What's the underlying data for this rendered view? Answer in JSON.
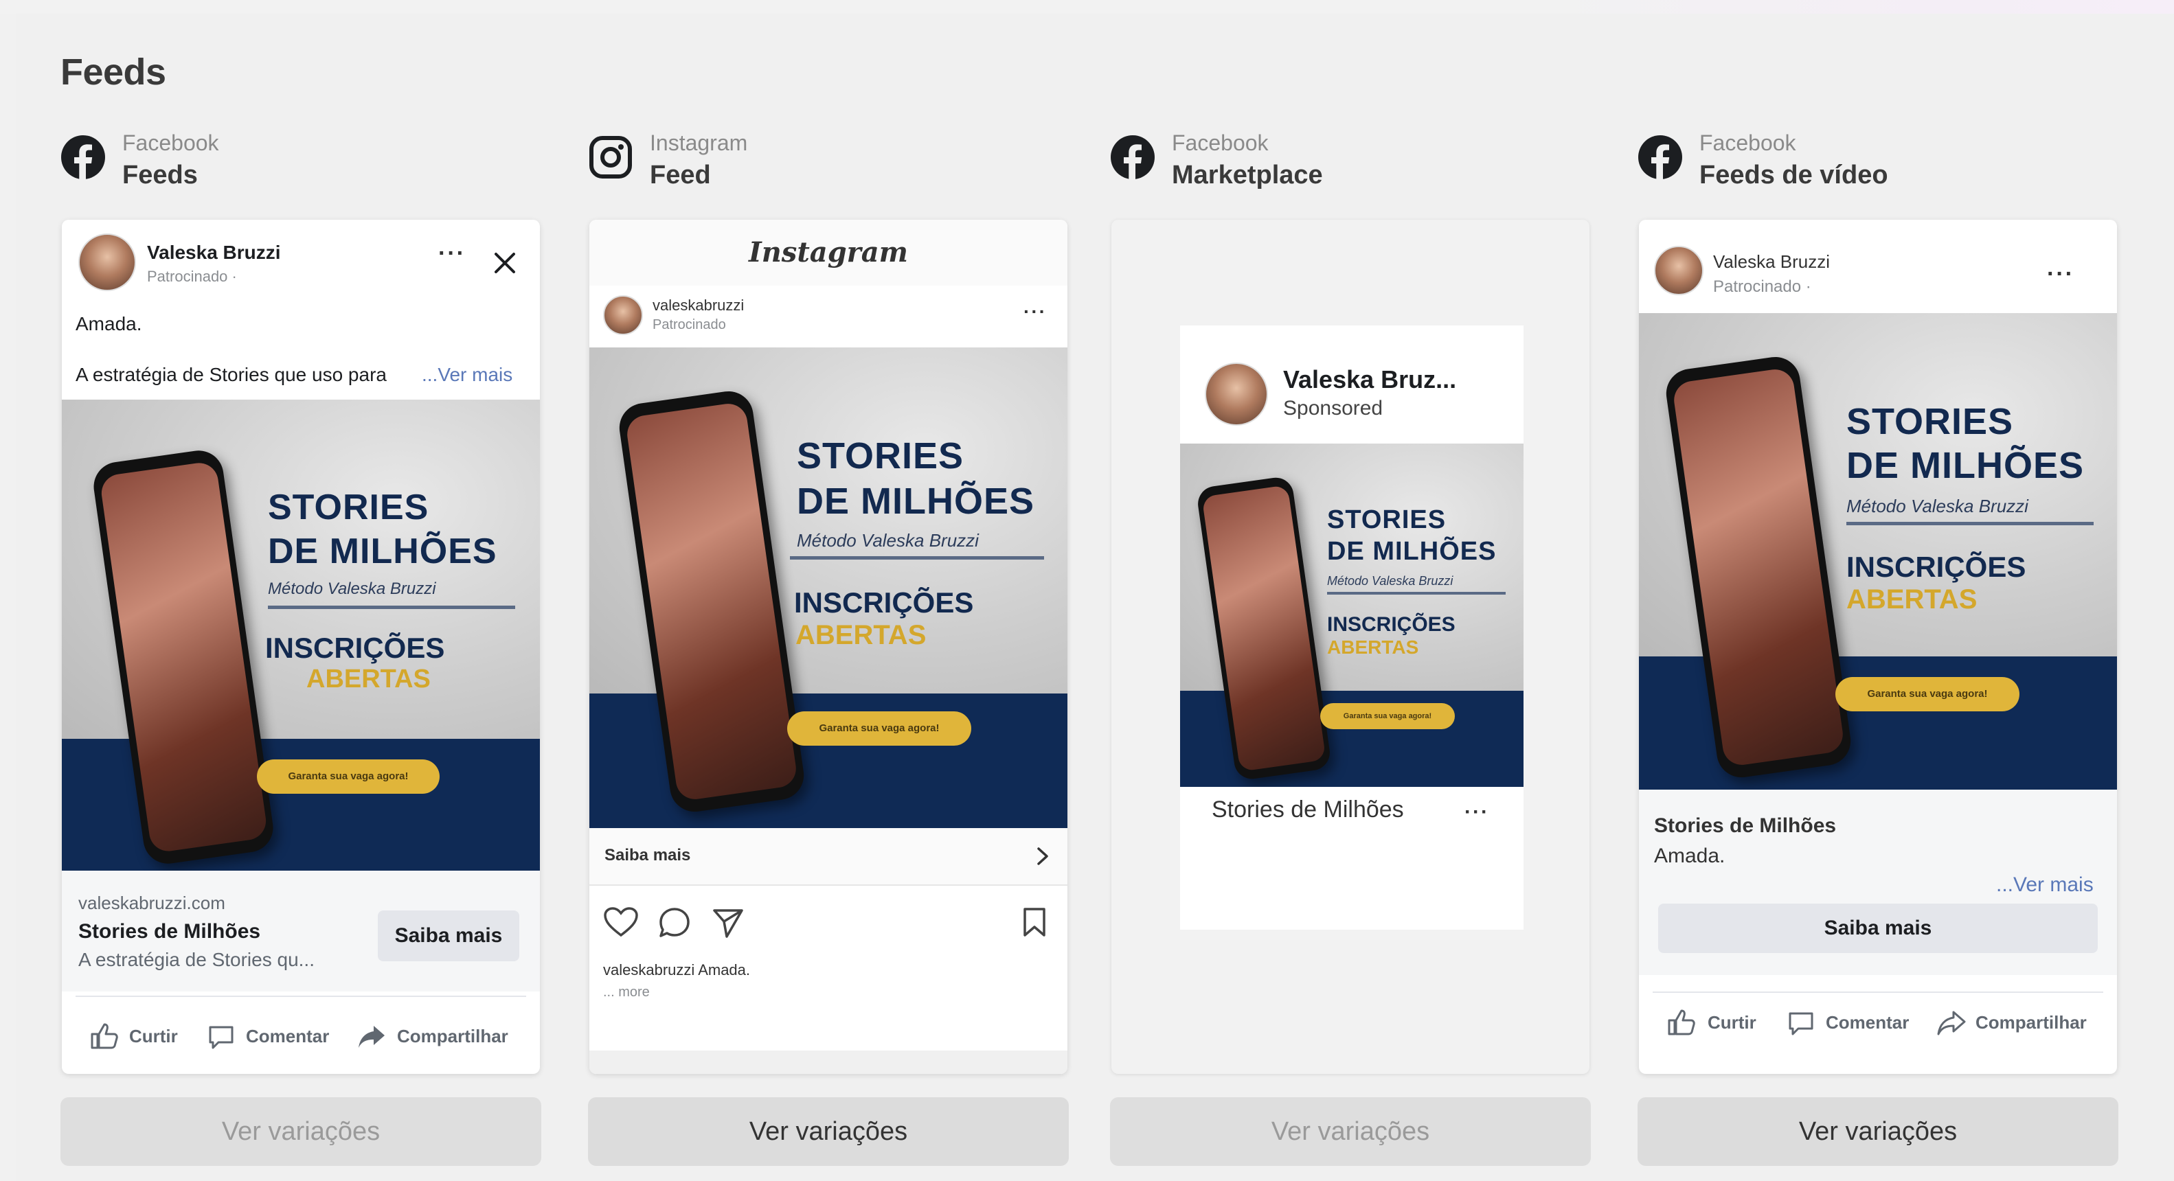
{
  "section_title": "Feeds",
  "colors": {
    "creative_navy": "#0f2a55",
    "creative_gold": "#e0b53a",
    "facebook_icon": "#1c1e21"
  },
  "columns": [
    {
      "platform": "Facebook",
      "placement": "Feeds",
      "icon": "facebook-icon",
      "button_label": "Ver variações",
      "button_enabled": false
    },
    {
      "platform": "Instagram",
      "placement": "Feed",
      "icon": "instagram-icon",
      "button_label": "Ver variações",
      "button_enabled": true
    },
    {
      "platform": "Facebook",
      "placement": "Marketplace",
      "icon": "facebook-icon",
      "button_label": "Ver variações",
      "button_enabled": false
    },
    {
      "platform": "Facebook",
      "placement": "Feeds de vídeo",
      "icon": "facebook-icon",
      "button_label": "Ver variações",
      "button_enabled": true
    }
  ],
  "creative": {
    "headline_line1": "STORIES",
    "headline_line2": "DE MILHÕES",
    "subtitle": "Método Valeska Bruzzi",
    "inscricoes": "INSCRIÇÕES",
    "abertas": "ABERTAS",
    "cta": "Garanta sua vaga agora!"
  },
  "fb_feed": {
    "author": "Valeska Bruzzi",
    "sponsored": "Patrocinado ·",
    "primary_text_1": "Amada.",
    "primary_text_2": "A estratégia de Stories que uso para",
    "see_more": "...Ver mais",
    "domain": "valeskabruzzi.com",
    "link_title": "Stories de Milhões",
    "link_desc": "A estratégia de Stories qu...",
    "cta_button": "Saiba mais",
    "like": "Curtir",
    "comment": "Comentar",
    "share": "Compartilhar"
  },
  "ig_feed": {
    "logo": "Instagram",
    "username": "valeskabruzzi",
    "sponsored": "Patrocinado",
    "cta_bar": "Saiba mais",
    "caption_user": "valeskabruzzi",
    "caption_text": "Amada.",
    "more": "... more"
  },
  "marketplace": {
    "author": "Valeska Bruz...",
    "sponsored": "Sponsored",
    "title": "Stories de Milhões"
  },
  "fb_video": {
    "author": "Valeska Bruzzi",
    "sponsored": "Patrocinado ·",
    "title": "Stories de Milhões",
    "text": "Amada.",
    "see_more": "...Ver mais",
    "cta_button": "Saiba mais",
    "like": "Curtir",
    "comment": "Comentar",
    "share": "Compartilhar"
  }
}
